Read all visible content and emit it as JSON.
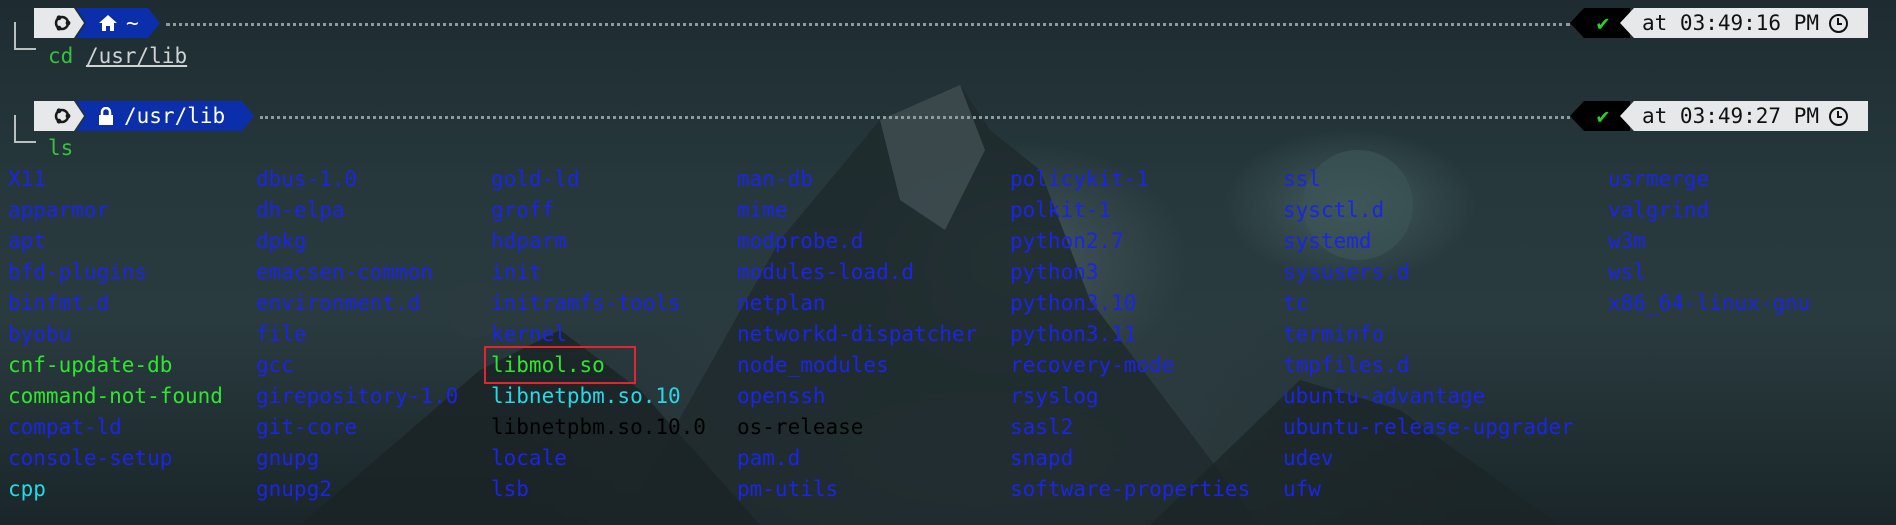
{
  "prompt1": {
    "os_icon": "ubuntu-icon",
    "dir_icon": "home-icon",
    "path": "~",
    "status_icon": "checkmark-icon",
    "status": "✔",
    "time": "at 03:49:16 PM",
    "command": "cd",
    "argument": "/usr/lib"
  },
  "prompt2": {
    "os_icon": "ubuntu-icon",
    "dir_icon": "lock-icon",
    "path": "/usr/lib",
    "status_icon": "checkmark-icon",
    "status": "✔",
    "time": "at 03:49:27 PM",
    "command": "ls"
  },
  "colors": {
    "directory": "#1a25e6",
    "symlink": "#27d8e6",
    "executable": "#2ee62e",
    "file": "#d8dadb",
    "highlight_box": "#e2262f"
  },
  "listing": {
    "columns": [
      [
        {
          "name": "X11",
          "type": "dir"
        },
        {
          "name": "apparmor",
          "type": "dir"
        },
        {
          "name": "apt",
          "type": "dir"
        },
        {
          "name": "bfd-plugins",
          "type": "dir"
        },
        {
          "name": "binfmt.d",
          "type": "dir"
        },
        {
          "name": "byobu",
          "type": "dir"
        },
        {
          "name": "cnf-update-db",
          "type": "exec"
        },
        {
          "name": "command-not-found",
          "type": "exec"
        },
        {
          "name": "compat-ld",
          "type": "dir"
        },
        {
          "name": "console-setup",
          "type": "dir"
        },
        {
          "name": "cpp",
          "type": "link"
        }
      ],
      [
        {
          "name": "dbus-1.0",
          "type": "dir"
        },
        {
          "name": "dh-elpa",
          "type": "dir"
        },
        {
          "name": "dpkg",
          "type": "dir"
        },
        {
          "name": "emacsen-common",
          "type": "dir"
        },
        {
          "name": "environment.d",
          "type": "dir"
        },
        {
          "name": "file",
          "type": "dir"
        },
        {
          "name": "gcc",
          "type": "dir"
        },
        {
          "name": "girepository-1.0",
          "type": "dir"
        },
        {
          "name": "git-core",
          "type": "dir"
        },
        {
          "name": "gnupg",
          "type": "dir"
        },
        {
          "name": "gnupg2",
          "type": "dir"
        }
      ],
      [
        {
          "name": "gold-ld",
          "type": "dir"
        },
        {
          "name": "groff",
          "type": "dir"
        },
        {
          "name": "hdparm",
          "type": "dir"
        },
        {
          "name": "init",
          "type": "dir"
        },
        {
          "name": "initramfs-tools",
          "type": "dir"
        },
        {
          "name": "kernel",
          "type": "dir"
        },
        {
          "name": "libmol.so",
          "type": "exec",
          "highlighted": true
        },
        {
          "name": "libnetpbm.so.10",
          "type": "link"
        },
        {
          "name": "libnetpbm.so.10.0",
          "type": "file"
        },
        {
          "name": "locale",
          "type": "dir"
        },
        {
          "name": "lsb",
          "type": "dir"
        }
      ],
      [
        {
          "name": "man-db",
          "type": "dir"
        },
        {
          "name": "mime",
          "type": "dir"
        },
        {
          "name": "modprobe.d",
          "type": "dir"
        },
        {
          "name": "modules-load.d",
          "type": "dir"
        },
        {
          "name": "netplan",
          "type": "dir"
        },
        {
          "name": "networkd-dispatcher",
          "type": "dir"
        },
        {
          "name": "node_modules",
          "type": "dir"
        },
        {
          "name": "openssh",
          "type": "dir"
        },
        {
          "name": "os-release",
          "type": "file"
        },
        {
          "name": "pam.d",
          "type": "dir"
        },
        {
          "name": "pm-utils",
          "type": "dir"
        }
      ],
      [
        {
          "name": "policykit-1",
          "type": "dir"
        },
        {
          "name": "polkit-1",
          "type": "dir"
        },
        {
          "name": "python2.7",
          "type": "dir"
        },
        {
          "name": "python3",
          "type": "dir"
        },
        {
          "name": "python3.10",
          "type": "dir"
        },
        {
          "name": "python3.11",
          "type": "dir"
        },
        {
          "name": "recovery-mode",
          "type": "dir"
        },
        {
          "name": "rsyslog",
          "type": "dir"
        },
        {
          "name": "sasl2",
          "type": "dir"
        },
        {
          "name": "snapd",
          "type": "dir"
        },
        {
          "name": "software-properties",
          "type": "dir"
        }
      ],
      [
        {
          "name": "ssl",
          "type": "dir"
        },
        {
          "name": "sysctl.d",
          "type": "dir"
        },
        {
          "name": "systemd",
          "type": "dir"
        },
        {
          "name": "sysusers.d",
          "type": "dir"
        },
        {
          "name": "tc",
          "type": "dir"
        },
        {
          "name": "terminfo",
          "type": "dir"
        },
        {
          "name": "tmpfiles.d",
          "type": "dir"
        },
        {
          "name": "ubuntu-advantage",
          "type": "dir"
        },
        {
          "name": "ubuntu-release-upgrader",
          "type": "dir"
        },
        {
          "name": "udev",
          "type": "dir"
        },
        {
          "name": "ufw",
          "type": "dir"
        }
      ],
      [
        {
          "name": "usrmerge",
          "type": "dir"
        },
        {
          "name": "valgrind",
          "type": "dir"
        },
        {
          "name": "w3m",
          "type": "dir"
        },
        {
          "name": "wsl",
          "type": "dir"
        },
        {
          "name": "x86_64-linux-gnu",
          "type": "dir"
        }
      ]
    ]
  }
}
